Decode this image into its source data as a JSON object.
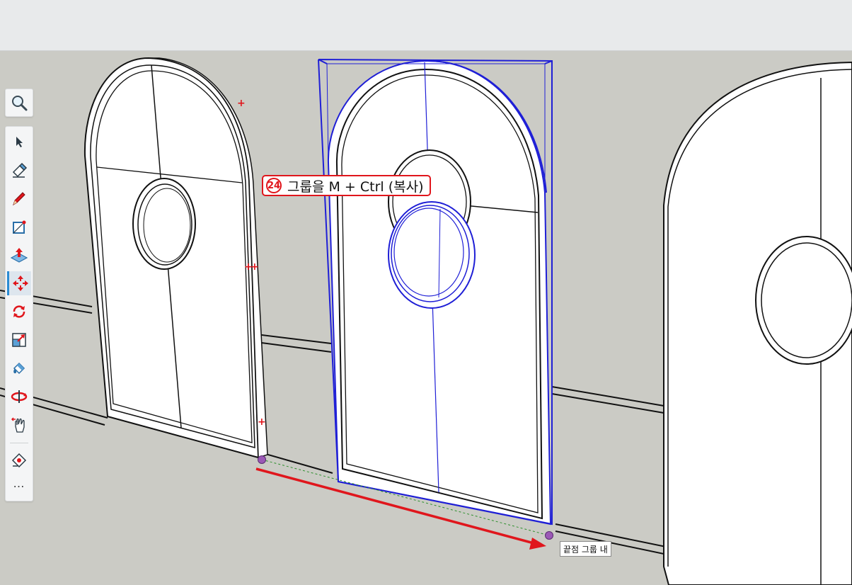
{
  "toolbar": {
    "tools": [
      {
        "name": "select",
        "icon": "select-arrow-icon",
        "active": false
      },
      {
        "name": "eraser",
        "icon": "eraser-icon",
        "active": false
      },
      {
        "name": "line",
        "icon": "pencil-icon",
        "active": false
      },
      {
        "name": "rectangle",
        "icon": "rectangle-icon",
        "active": false
      },
      {
        "name": "push-pull",
        "icon": "push-pull-icon",
        "active": false
      },
      {
        "name": "move",
        "icon": "move-icon",
        "active": true
      },
      {
        "name": "rotate",
        "icon": "rotate-icon",
        "active": false
      },
      {
        "name": "scale",
        "icon": "scale-icon",
        "active": false
      },
      {
        "name": "paint-bucket",
        "icon": "paint-bucket-icon",
        "active": false
      },
      {
        "name": "orbit",
        "icon": "orbit-icon",
        "active": false
      },
      {
        "name": "pan",
        "icon": "pan-hand-icon",
        "active": false
      },
      {
        "name": "tape-measure",
        "icon": "tape-measure-icon",
        "active": false
      }
    ],
    "more_label": "⋯"
  },
  "callout": {
    "number": "24",
    "text": "그룹을 M + Ctrl (복사)"
  },
  "tooltip": {
    "text": "끝점 그룹 내"
  },
  "colors": {
    "background": "#cbcbc5",
    "selection": "#1f1fd6",
    "annotation": "#e0161c",
    "endpoint": "#9b59b6"
  }
}
